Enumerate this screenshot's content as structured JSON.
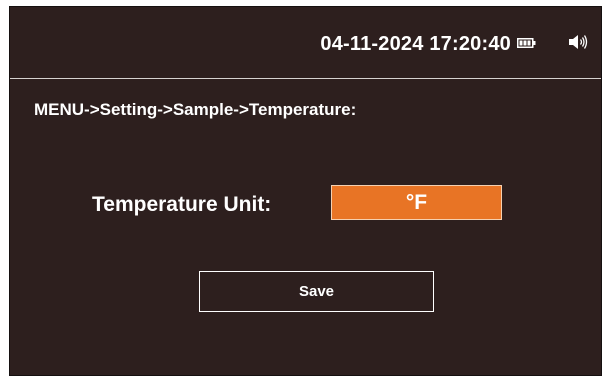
{
  "status_bar": {
    "datetime": "04-11-2024 17:20:40",
    "battery_icon": "battery-icon",
    "speaker_icon": "speaker-icon"
  },
  "breadcrumb": "MENU->Setting->Sample->Temperature:",
  "temperature": {
    "label": "Temperature Unit:",
    "selected_unit": "°F"
  },
  "save_label": "Save",
  "colors": {
    "screen_background": "#2d1f1e",
    "accent": "#e87425",
    "text": "#ffffff"
  }
}
